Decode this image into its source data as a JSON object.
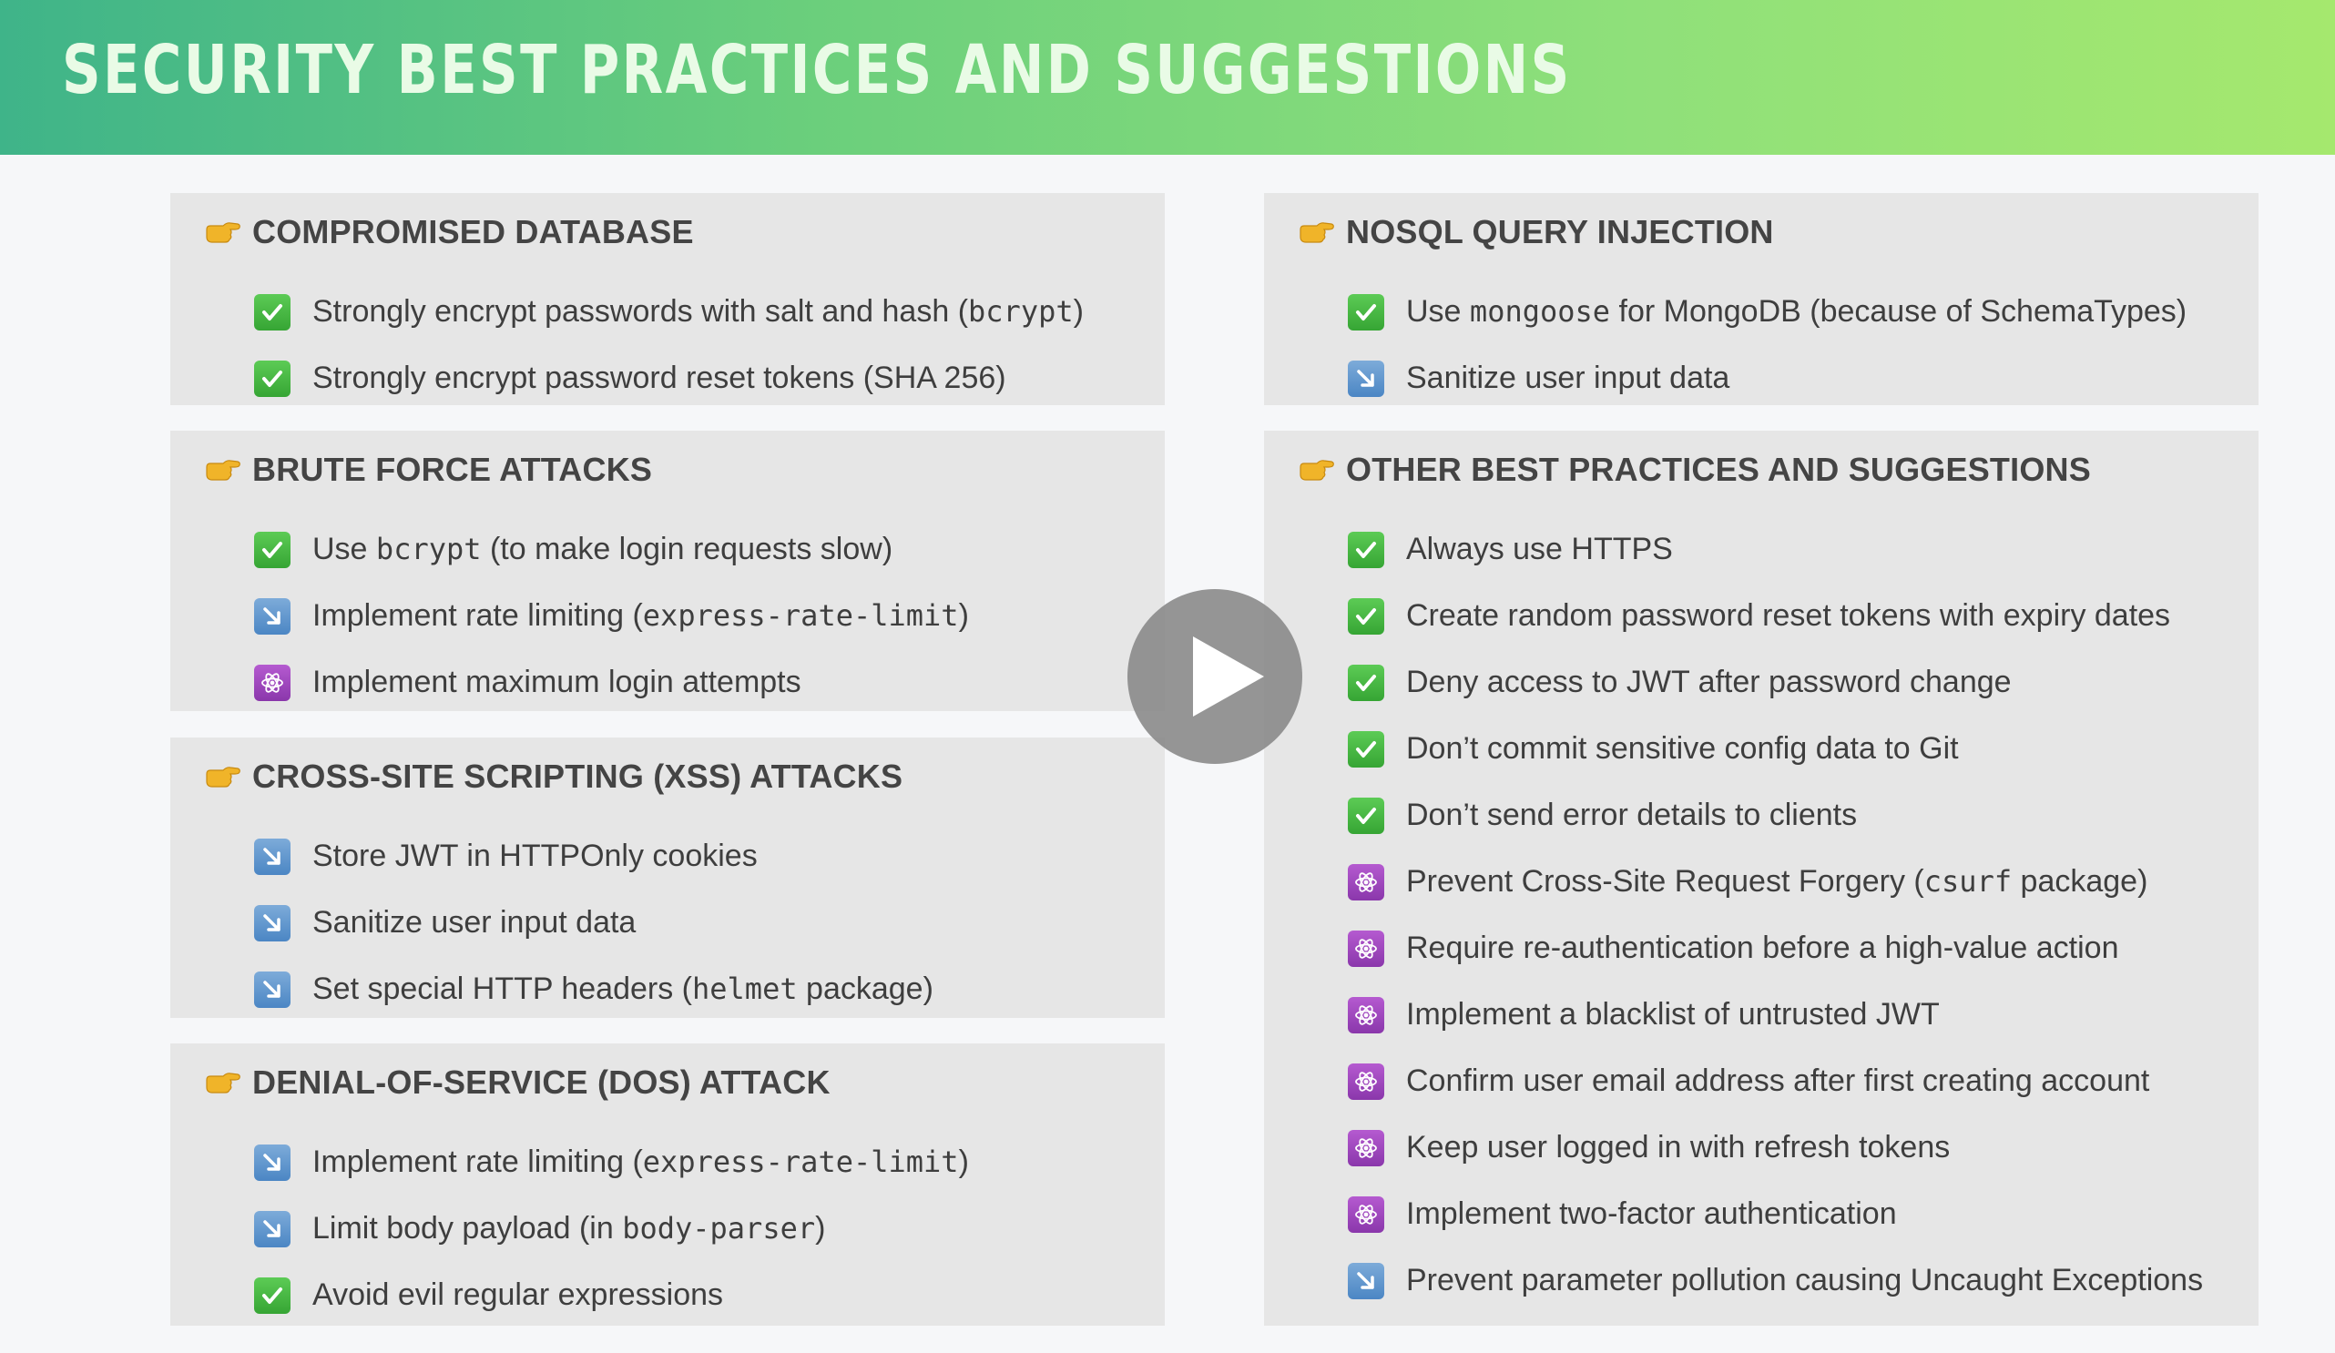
{
  "header": {
    "title": "SECURITY BEST PRACTICES AND SUGGESTIONS",
    "gradient": [
      "#3fb489",
      "#a5e86e"
    ]
  },
  "colors": {
    "check": "#3fae3a",
    "arrow": "#5a93cc",
    "atom": "#9a44bd",
    "card_bg": "#e6e6e6",
    "hand": "#f0b429"
  },
  "cards": [
    {
      "title": "COMPROMISED DATABASE",
      "items": [
        {
          "icon": "check-icon",
          "parts": [
            {
              "t": "Strongly encrypt passwords with salt and hash ("
            },
            {
              "t": "bcrypt",
              "code": true
            },
            {
              "t": ")"
            }
          ]
        },
        {
          "icon": "check-icon",
          "parts": [
            {
              "t": "Strongly encrypt password reset tokens (SHA 256)"
            }
          ]
        }
      ]
    },
    {
      "title": "BRUTE FORCE ATTACKS",
      "items": [
        {
          "icon": "check-icon",
          "parts": [
            {
              "t": "Use "
            },
            {
              "t": "bcrypt",
              "code": true
            },
            {
              "t": " (to make login requests slow)"
            }
          ]
        },
        {
          "icon": "arrow-icon",
          "parts": [
            {
              "t": "Implement rate limiting ("
            },
            {
              "t": "express-rate-limit",
              "code": true
            },
            {
              "t": ")"
            }
          ]
        },
        {
          "icon": "atom-icon",
          "parts": [
            {
              "t": "Implement maximum login attempts"
            }
          ]
        }
      ]
    },
    {
      "title": "CROSS-SITE SCRIPTING (XSS) ATTACKS",
      "items": [
        {
          "icon": "arrow-icon",
          "parts": [
            {
              "t": "Store JWT in HTTPOnly cookies"
            }
          ]
        },
        {
          "icon": "arrow-icon",
          "parts": [
            {
              "t": "Sanitize user input data"
            }
          ]
        },
        {
          "icon": "arrow-icon",
          "parts": [
            {
              "t": "Set special HTTP headers ("
            },
            {
              "t": "helmet",
              "code": true
            },
            {
              "t": " package)"
            }
          ]
        }
      ]
    },
    {
      "title": "DENIAL-OF-SERVICE (DOS) ATTACK",
      "items": [
        {
          "icon": "arrow-icon",
          "parts": [
            {
              "t": "Implement rate limiting ("
            },
            {
              "t": "express-rate-limit",
              "code": true
            },
            {
              "t": ")"
            }
          ]
        },
        {
          "icon": "arrow-icon",
          "parts": [
            {
              "t": "Limit body payload (in "
            },
            {
              "t": "body-parser",
              "code": true
            },
            {
              "t": ")"
            }
          ]
        },
        {
          "icon": "check-icon",
          "parts": [
            {
              "t": "Avoid evil regular expressions"
            }
          ]
        }
      ]
    },
    {
      "title": "NOSQL QUERY INJECTION",
      "items": [
        {
          "icon": "check-icon",
          "parts": [
            {
              "t": "Use "
            },
            {
              "t": "mongoose",
              "code": true
            },
            {
              "t": " for MongoDB (because of SchemaTypes)"
            }
          ]
        },
        {
          "icon": "arrow-icon",
          "parts": [
            {
              "t": "Sanitize user input data"
            }
          ]
        }
      ]
    },
    {
      "title": "OTHER BEST PRACTICES AND SUGGESTIONS",
      "items": [
        {
          "icon": "check-icon",
          "parts": [
            {
              "t": "Always use HTTPS"
            }
          ]
        },
        {
          "icon": "check-icon",
          "parts": [
            {
              "t": "Create random password reset tokens with expiry dates"
            }
          ]
        },
        {
          "icon": "check-icon",
          "parts": [
            {
              "t": "Deny access to JWT after password change"
            }
          ]
        },
        {
          "icon": "check-icon",
          "parts": [
            {
              "t": "Don’t commit sensitive config data to Git"
            }
          ]
        },
        {
          "icon": "check-icon",
          "parts": [
            {
              "t": "Don’t send error details to clients"
            }
          ]
        },
        {
          "icon": "atom-icon",
          "parts": [
            {
              "t": "Prevent Cross-Site Request Forgery ("
            },
            {
              "t": "csurf",
              "code": true
            },
            {
              "t": " package)"
            }
          ]
        },
        {
          "icon": "atom-icon",
          "parts": [
            {
              "t": "Require re-authentication before a high-value action"
            }
          ]
        },
        {
          "icon": "atom-icon",
          "parts": [
            {
              "t": "Implement a blacklist of untrusted JWT"
            }
          ]
        },
        {
          "icon": "atom-icon",
          "parts": [
            {
              "t": "Confirm user email address after first creating account"
            }
          ]
        },
        {
          "icon": "atom-icon",
          "parts": [
            {
              "t": "Keep user logged in with refresh tokens"
            }
          ]
        },
        {
          "icon": "atom-icon",
          "parts": [
            {
              "t": "Implement two-factor authentication"
            }
          ]
        },
        {
          "icon": "arrow-icon",
          "parts": [
            {
              "t": "Prevent parameter pollution causing Uncaught Exceptions"
            }
          ]
        }
      ]
    }
  ],
  "player": {
    "icon": "play-icon"
  }
}
